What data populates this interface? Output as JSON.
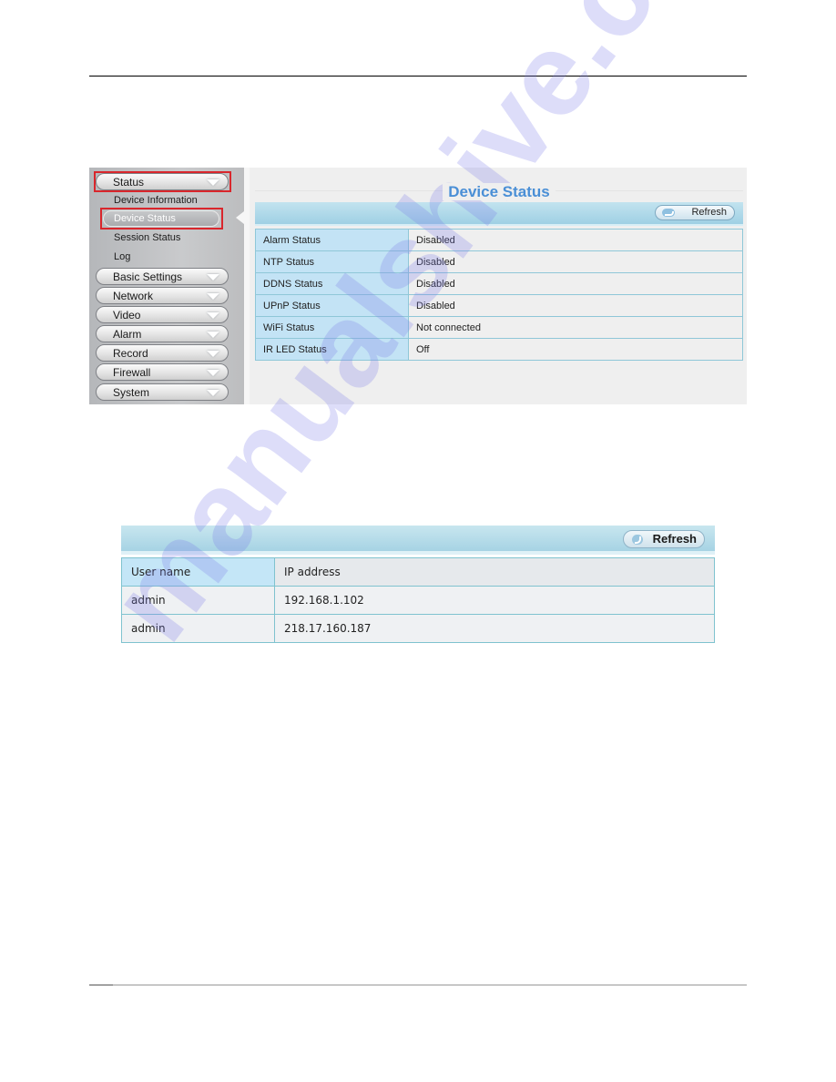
{
  "device_status_screen": {
    "sidebar": {
      "menus": [
        {
          "label": "Status",
          "expanded": true,
          "highlighted": true
        },
        {
          "label": "Basic Settings"
        },
        {
          "label": "Network"
        },
        {
          "label": "Video"
        },
        {
          "label": "Alarm"
        },
        {
          "label": "Record"
        },
        {
          "label": "Firewall"
        },
        {
          "label": "System"
        }
      ],
      "status_subitems": [
        {
          "label": "Device Information"
        },
        {
          "label": "Device Status",
          "active": true,
          "highlighted": true
        },
        {
          "label": "Session Status"
        },
        {
          "label": "Log"
        }
      ]
    },
    "title": "Device Status",
    "refresh_label": "Refresh",
    "rows": [
      {
        "key": "Alarm Status",
        "value": "Disabled"
      },
      {
        "key": "NTP Status",
        "value": "Disabled"
      },
      {
        "key": "DDNS Status",
        "value": "Disabled"
      },
      {
        "key": "UPnP Status",
        "value": "Disabled"
      },
      {
        "key": "WiFi Status",
        "value": "Not connected"
      },
      {
        "key": "IR LED Status",
        "value": "Off"
      }
    ]
  },
  "session_status_screen": {
    "refresh_label": "Refresh",
    "columns": [
      "User name",
      "IP address"
    ],
    "rows": [
      [
        "admin",
        "192.168.1.102"
      ],
      [
        "admin",
        "218.17.160.187"
      ]
    ]
  },
  "watermark": "manualshive.com",
  "colors": {
    "title_blue": "#4a8fd6",
    "highlight_red": "#d9262c",
    "toolbar_blue": "#a6d3e4"
  }
}
